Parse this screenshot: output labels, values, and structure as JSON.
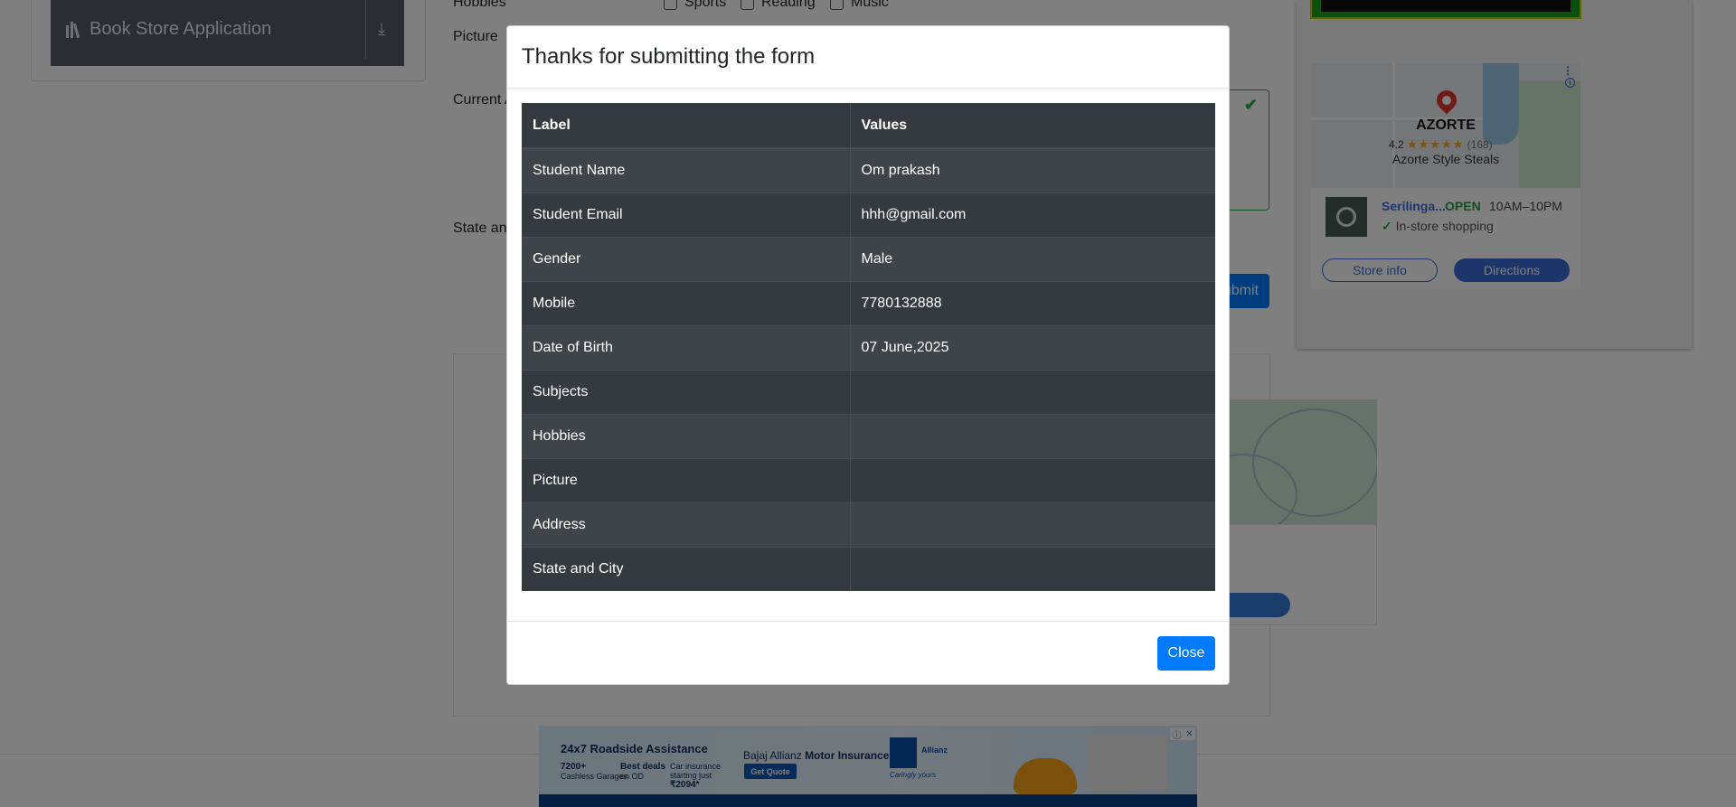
{
  "sidebar": {
    "item_label": "Book Store Application",
    "item_icon": "books-icon",
    "download_icon": "download-icon"
  },
  "form": {
    "hobbies_label": "Hobbies",
    "hobbies": [
      "Sports",
      "Reading",
      "Music"
    ],
    "picture_label": "Picture",
    "current_address_label": "Current A",
    "state_city_label": "State anc",
    "submit_label": "ubmit"
  },
  "map_ad": {
    "place_name": "AZORTE",
    "rating": "4.2",
    "stars": "★★★★★",
    "review_count": "(168)",
    "subtitle": "Azorte Style Steals",
    "store_name": "Serilinga...",
    "open_status": "OPEN",
    "hours": "10AM–10PM",
    "feature": "In-store shopping",
    "store_info_label": "Store info",
    "directions_label": "Directions",
    "accent": "#3b6bd6"
  },
  "bottom_ad": {
    "headline": "24x7 Roadside Assistance",
    "stat1_value": "7200+",
    "stat1_text": "Cashless Garages",
    "stat2_value": "Best deals",
    "stat2_text": "on OD",
    "stat3_text": "Car insurance starting just",
    "stat3_value": "₹2094*",
    "brand_prefix": "Bajaj Allianz",
    "brand_suffix": "Motor Insurance",
    "cta": "Get Quote",
    "logo_text": "Allianz",
    "tagline": "Caringly yours"
  },
  "modal": {
    "title": "Thanks for submitting the form",
    "columns": [
      "Label",
      "Values"
    ],
    "rows": [
      {
        "label": "Student Name",
        "value": "Om prakash"
      },
      {
        "label": "Student Email",
        "value": "hhh@gmail.com"
      },
      {
        "label": "Gender",
        "value": "Male"
      },
      {
        "label": "Mobile",
        "value": "7780132888"
      },
      {
        "label": "Date of Birth",
        "value": "07 June,2025"
      },
      {
        "label": "Subjects",
        "value": ""
      },
      {
        "label": "Hobbies",
        "value": ""
      },
      {
        "label": "Picture",
        "value": ""
      },
      {
        "label": "Address",
        "value": ""
      },
      {
        "label": "State and City",
        "value": ""
      }
    ],
    "close_label": "Close",
    "accent": "#007bff",
    "table_bg": "#343a40"
  }
}
